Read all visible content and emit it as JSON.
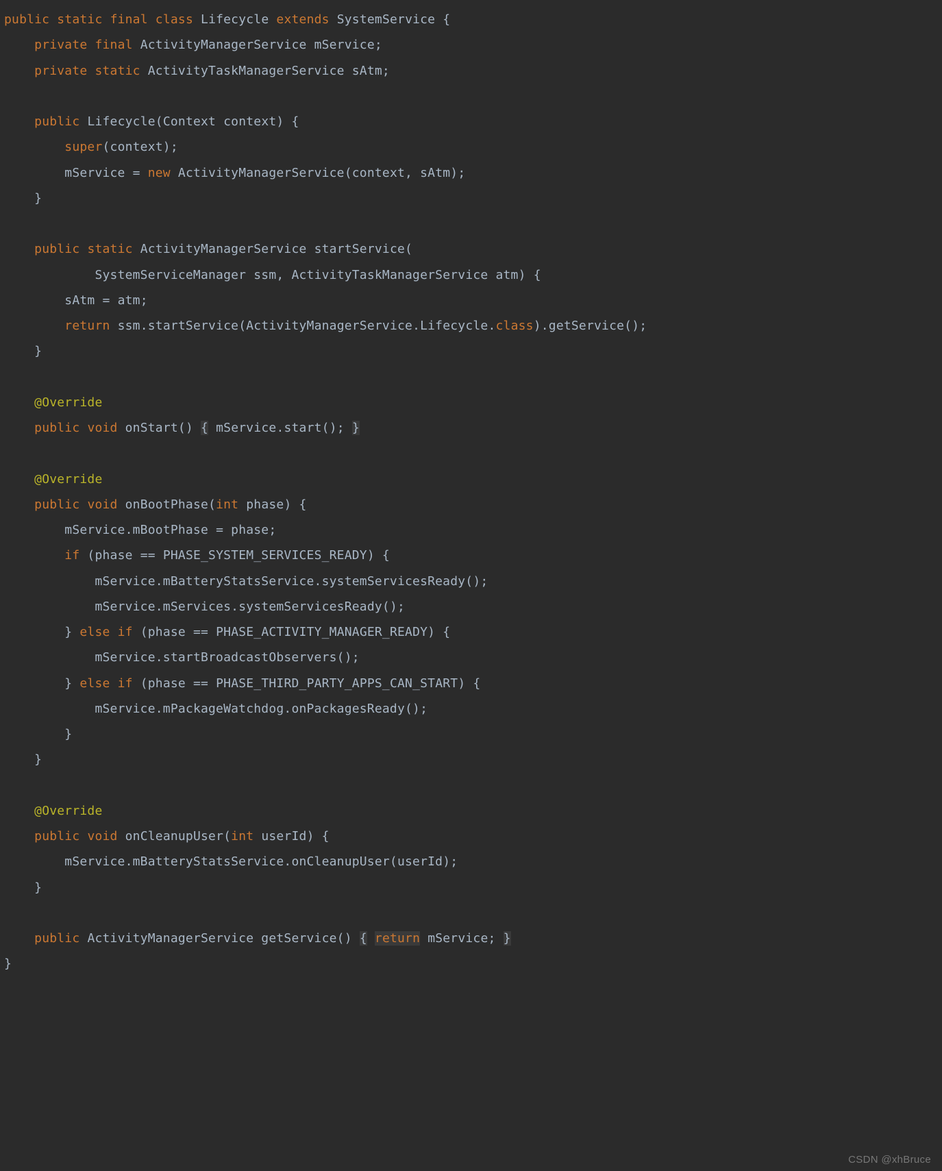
{
  "watermark": "CSDN @xhBruce",
  "tokens": {
    "kw_public": "public",
    "kw_static": "static",
    "kw_final": "final",
    "kw_class": "class",
    "kw_extends": "extends",
    "kw_private": "private",
    "kw_super": "super",
    "kw_new": "new",
    "kw_return": "return",
    "kw_void": "void",
    "kw_int": "int",
    "kw_if": "if",
    "kw_else": "else",
    "dot_class": "class",
    "ann_override": "@Override",
    "cls_Lifecycle": "Lifecycle",
    "cls_SystemService": "SystemService",
    "cls_ActivityManagerService": "ActivityManagerService",
    "cls_ActivityTaskManagerService": "ActivityTaskManagerService",
    "cls_Context": "Context",
    "cls_SystemServiceManager": "SystemServiceManager",
    "fld_mService": "mService",
    "fld_sAtm": "sAtm",
    "fld_mBootPhase": "mBootPhase",
    "fld_mBatteryStatsService": "mBatteryStatsService",
    "fld_mServices": "mServices",
    "fld_mPackageWatchdog": "mPackageWatchdog",
    "var_context": "context",
    "var_ssm": "ssm",
    "var_atm": "atm",
    "var_phase": "phase",
    "var_userId": "userId",
    "m_startService": "startService",
    "m_getService": "getService",
    "m_onStart": "onStart",
    "m_start": "start",
    "m_onBootPhase": "onBootPhase",
    "m_systemServicesReady": "systemServicesReady",
    "m_startBroadcastObservers": "startBroadcastObservers",
    "m_onPackagesReady": "onPackagesReady",
    "m_onCleanupUser": "onCleanupUser",
    "c_PHASE_SYSTEM_SERVICES_READY": "PHASE_SYSTEM_SERVICES_READY",
    "c_PHASE_ACTIVITY_MANAGER_READY": "PHASE_ACTIVITY_MANAGER_READY",
    "c_PHASE_THIRD_PARTY_APPS_CAN_START": "PHASE_THIRD_PARTY_APPS_CAN_START",
    "p_lbrace": "{",
    "p_rbrace": "}",
    "p_lparen": "(",
    "p_rparen": ")",
    "p_semi": ";",
    "p_comma": ",",
    "p_dot": ".",
    "p_eq": "=",
    "p_eqeq": "=="
  }
}
